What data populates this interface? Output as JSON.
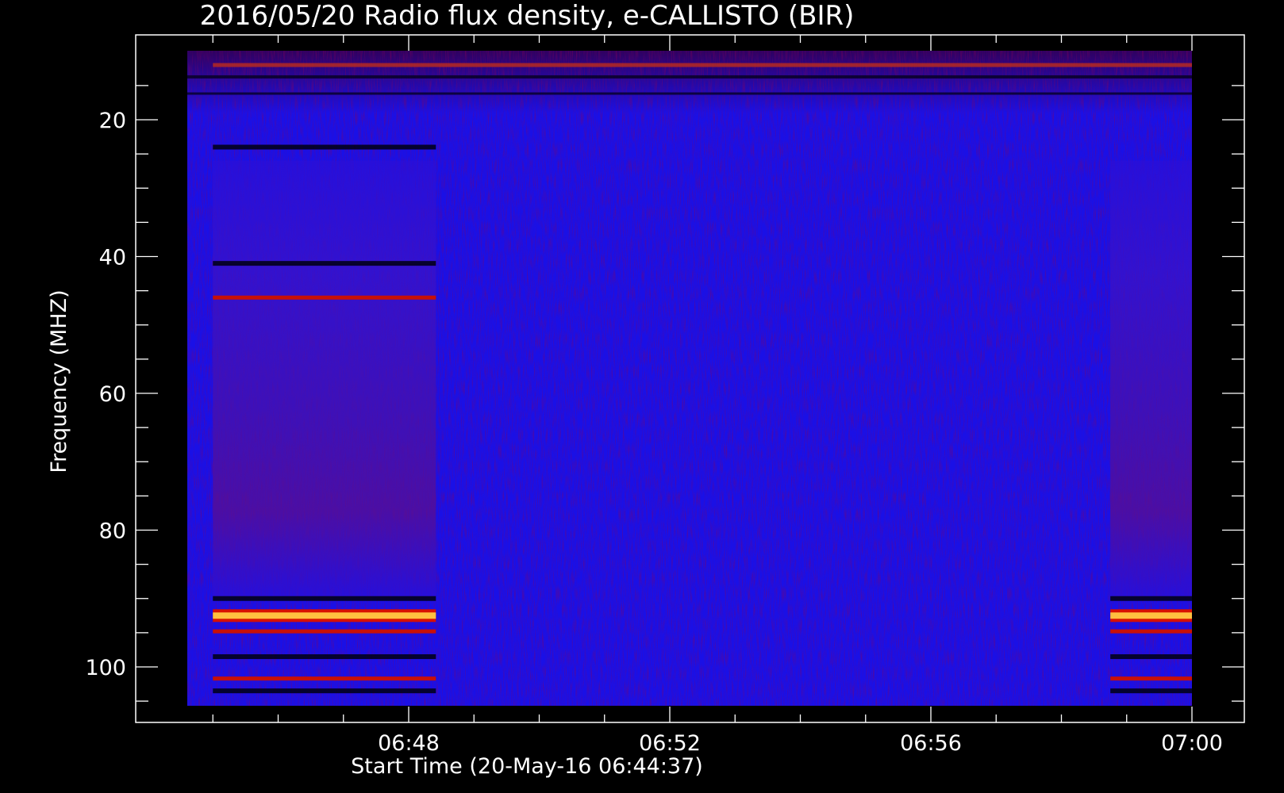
{
  "chart_data": {
    "type": "heatmap",
    "title": "2016/05/20  Radio flux density, e-CALLISTO (BIR)",
    "xlabel": "Start Time (20-May-16 06:44:37)",
    "ylabel": "Frequency (MHZ)",
    "x_ticks": [
      "06:48",
      "06:52",
      "06:56",
      "07:00"
    ],
    "y_ticks": [
      "20",
      "40",
      "60",
      "80",
      "100"
    ],
    "x_range": [
      "06:44:37",
      "07:00:00"
    ],
    "y_range_mhz": [
      10,
      105
    ],
    "y_axis_inverted": true,
    "grid": false,
    "colormap": "blue-red-yellow (low to high intensity)",
    "colors": {
      "background": "#000000",
      "low": "#1a10e6",
      "medium": "#8a0040",
      "high": "#d81000",
      "peak": "#ffd040"
    },
    "features": [
      {
        "name": "strong emission band",
        "freq_mhz": 92.5,
        "time_segments": [
          [
            "06:45:00",
            "06:48:25"
          ],
          [
            "06:58:45",
            "07:00:00"
          ]
        ]
      },
      {
        "name": "emission band",
        "freq_mhz": 94.8,
        "time_segments": [
          [
            "06:45:00",
            "06:48:25"
          ],
          [
            "06:58:45",
            "07:00:00"
          ]
        ]
      },
      {
        "name": "emission band",
        "freq_mhz": 101.7,
        "time_segments": [
          [
            "06:45:00",
            "06:48:25"
          ],
          [
            "06:58:45",
            "07:00:00"
          ]
        ]
      },
      {
        "name": "emission band",
        "freq_mhz": 46,
        "time_segments": [
          [
            "06:45:00",
            "06:48:25"
          ]
        ]
      },
      {
        "name": "interference band",
        "freq_mhz": 12,
        "time_segments": [
          [
            "06:45:00",
            "07:00:00"
          ]
        ]
      }
    ]
  }
}
